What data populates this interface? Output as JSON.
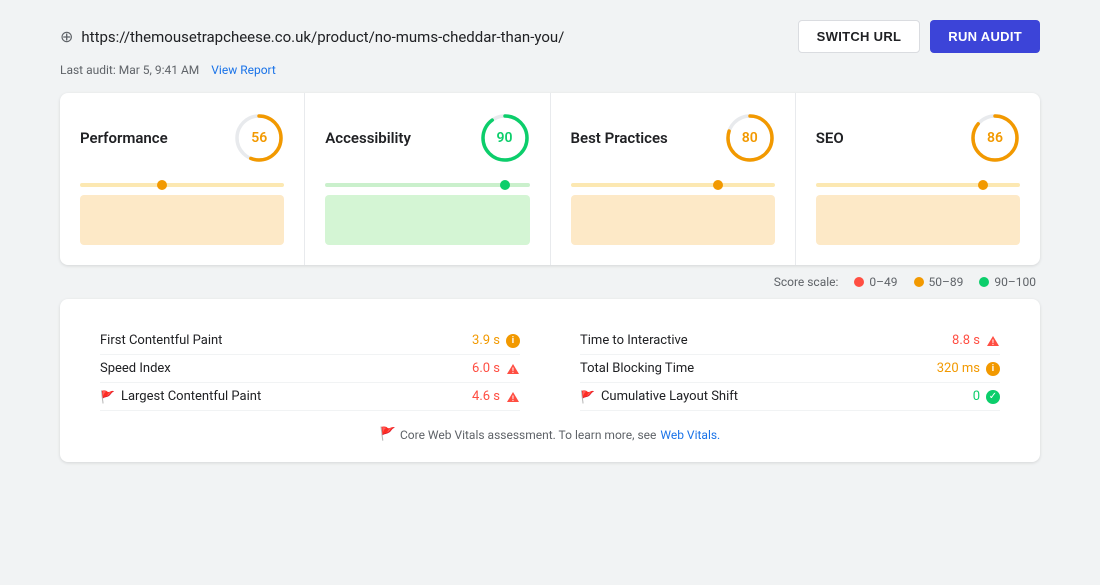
{
  "header": {
    "url": "https://themousetrapcheese.co.uk/product/no-mums-cheddar-than-you/",
    "last_audit": "Last audit: Mar 5, 9:41 AM",
    "view_report_label": "View Report",
    "switch_url_label": "SWITCH URL",
    "run_audit_label": "RUN AUDIT"
  },
  "score_scale": {
    "label": "Score scale:",
    "items": [
      {
        "label": "0–49",
        "color_class": "scale-red"
      },
      {
        "label": "50–89",
        "color_class": "scale-orange"
      },
      {
        "label": "90–100",
        "color_class": "scale-green"
      }
    ]
  },
  "cards": [
    {
      "title": "Performance",
      "score": "56",
      "score_class": "score-orange",
      "stroke_color": "#f29900",
      "stroke_pct": 56,
      "line_class": "perf-line",
      "dot_class": "perf-dot",
      "rect_class": "perf-rect",
      "dot_pct": 40
    },
    {
      "title": "Accessibility",
      "score": "90",
      "score_class": "score-green",
      "stroke_color": "#0cce6b",
      "stroke_pct": 90,
      "line_class": "acc-line",
      "dot_class": "acc-dot",
      "rect_class": "acc-rect",
      "dot_pct": 88
    },
    {
      "title": "Best Practices",
      "score": "80",
      "score_class": "score-orange",
      "stroke_color": "#f29900",
      "stroke_pct": 80,
      "line_class": "bp-line",
      "dot_class": "bp-dot",
      "rect_class": "bp-rect",
      "dot_pct": 72
    },
    {
      "title": "SEO",
      "score": "86",
      "score_class": "score-orange",
      "stroke_color": "#f29900",
      "stroke_pct": 86,
      "line_class": "seo-line",
      "dot_class": "seo-dot",
      "rect_class": "seo-rect",
      "dot_pct": 82
    }
  ],
  "metrics": {
    "left": [
      {
        "name": "First Contentful Paint",
        "value": "3.9 s",
        "value_color": "color-orange",
        "icon_type": "info",
        "has_flag": false
      },
      {
        "name": "Speed Index",
        "value": "6.0 s",
        "value_color": "color-red",
        "icon_type": "warn",
        "has_flag": false
      },
      {
        "name": "Largest Contentful Paint",
        "value": "4.6 s",
        "value_color": "color-red",
        "icon_type": "warn",
        "has_flag": true
      }
    ],
    "right": [
      {
        "name": "Time to Interactive",
        "value": "8.8 s",
        "value_color": "color-red",
        "icon_type": "warn",
        "has_flag": false
      },
      {
        "name": "Total Blocking Time",
        "value": "320 ms",
        "value_color": "color-orange",
        "icon_type": "info",
        "has_flag": false
      },
      {
        "name": "Cumulative Layout Shift",
        "value": "0",
        "value_color": "color-green",
        "icon_type": "check",
        "has_flag": true
      }
    ],
    "footer_text": "Core Web Vitals assessment. To learn more, see",
    "footer_link": "Web Vitals.",
    "footer_link_url": "#"
  }
}
